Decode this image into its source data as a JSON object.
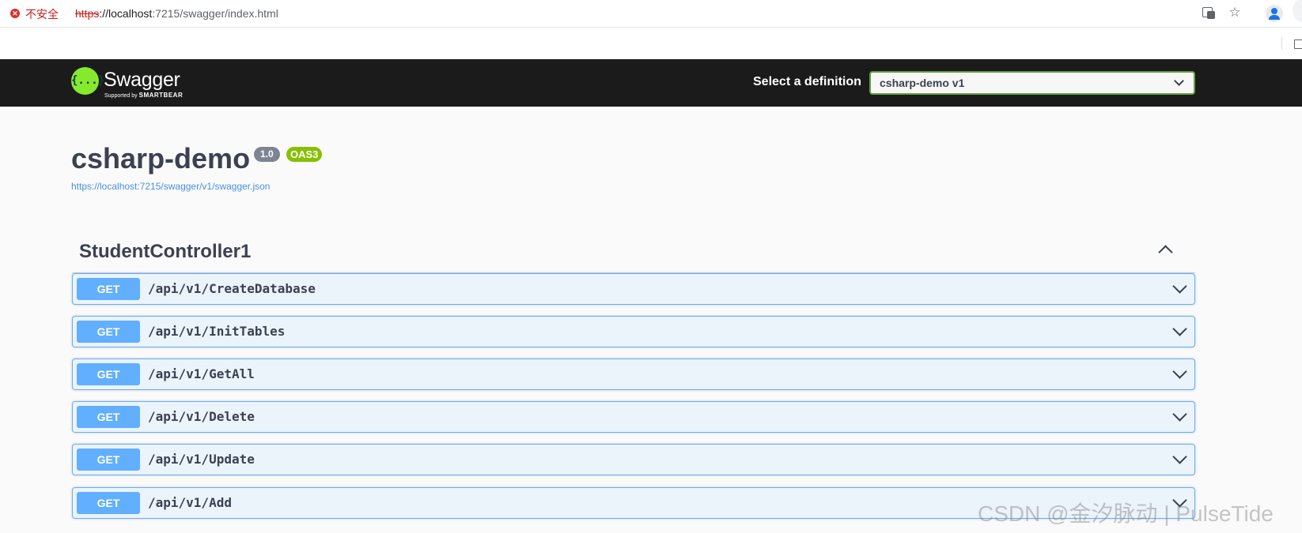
{
  "browser": {
    "security_label": "不安全",
    "url_scheme": "https",
    "url_host": "://localhost",
    "url_rest": ":7215/swagger/index.html"
  },
  "topbar": {
    "logo_mark": "{...}",
    "logo_text": "Swagger",
    "logo_sub_prefix": "Supported by",
    "logo_sub_brand": "SMARTBEAR",
    "select_label": "Select a definition",
    "select_value": "csharp-demo v1"
  },
  "info": {
    "title": "csharp-demo",
    "version": "1.0",
    "oas": "OAS3",
    "spec_url": "https://localhost:7215/swagger/v1/swagger.json"
  },
  "controller": {
    "name": "StudentController1",
    "operations": [
      {
        "method": "GET",
        "path": "/api/v1/CreateDatabase"
      },
      {
        "method": "GET",
        "path": "/api/v1/InitTables"
      },
      {
        "method": "GET",
        "path": "/api/v1/GetAll"
      },
      {
        "method": "GET",
        "path": "/api/v1/Delete"
      },
      {
        "method": "GET",
        "path": "/api/v1/Update"
      },
      {
        "method": "GET",
        "path": "/api/v1/Add"
      }
    ]
  },
  "watermark": "CSDN @金汐脉动 | PulseTide",
  "colors": {
    "topbar": "#1b1b1b",
    "get_accent": "#61affe",
    "get_background": "#ebf3fb",
    "logo_green": "#85ea2d",
    "oas_badge": "#89bf04"
  }
}
